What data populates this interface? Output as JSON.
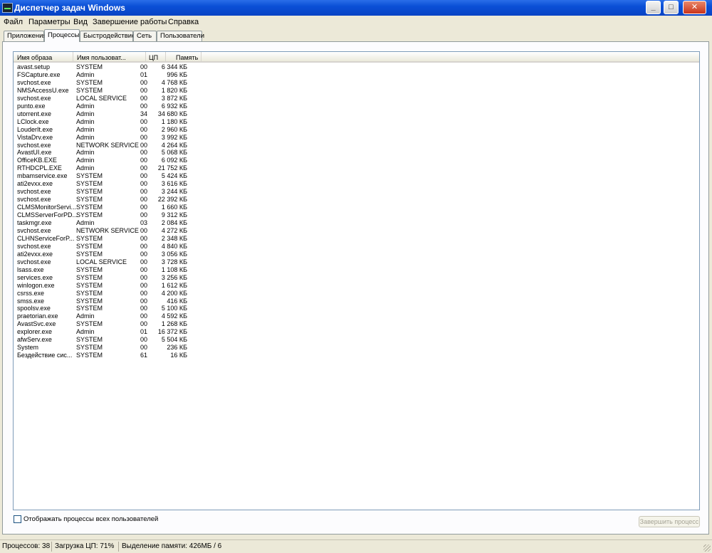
{
  "window": {
    "title": "Диспетчер задач Windows"
  },
  "menu": [
    "Файл",
    "Параметры",
    "Вид",
    "Завершение работы",
    "Справка"
  ],
  "tabs": [
    "Приложения",
    "Процессы",
    "Быстродействие",
    "Сеть",
    "Пользователи"
  ],
  "active_tab": "Процессы",
  "columns": [
    "Имя образа",
    "Имя пользоват...",
    "ЦП",
    "Память"
  ],
  "processes": [
    [
      "avast.setup",
      "SYSTEM",
      "00",
      "6 344 КБ"
    ],
    [
      "FSCapture.exe",
      "Admin",
      "01",
      "996 КБ"
    ],
    [
      "svchost.exe",
      "SYSTEM",
      "00",
      "4 768 КБ"
    ],
    [
      "NMSAccessU.exe",
      "SYSTEM",
      "00",
      "1 820 КБ"
    ],
    [
      "svchost.exe",
      "LOCAL SERVICE",
      "00",
      "3 872 КБ"
    ],
    [
      "punto.exe",
      "Admin",
      "00",
      "6 932 КБ"
    ],
    [
      "utorrent.exe",
      "Admin",
      "34",
      "34 680 КБ"
    ],
    [
      "LClock.exe",
      "Admin",
      "00",
      "1 180 КБ"
    ],
    [
      "LouderIt.exe",
      "Admin",
      "00",
      "2 960 КБ"
    ],
    [
      "VistaDrv.exe",
      "Admin",
      "00",
      "3 992 КБ"
    ],
    [
      "svchost.exe",
      "NETWORK SERVICE",
      "00",
      "4 264 КБ"
    ],
    [
      "AvastUI.exe",
      "Admin",
      "00",
      "5 068 КБ"
    ],
    [
      "OfficeKB.EXE",
      "Admin",
      "00",
      "6 092 КБ"
    ],
    [
      "RTHDCPL.EXE",
      "Admin",
      "00",
      "21 752 КБ"
    ],
    [
      "mbamservice.exe",
      "SYSTEM",
      "00",
      "5 424 КБ"
    ],
    [
      "ati2evxx.exe",
      "SYSTEM",
      "00",
      "3 616 КБ"
    ],
    [
      "svchost.exe",
      "SYSTEM",
      "00",
      "3 244 КБ"
    ],
    [
      "svchost.exe",
      "SYSTEM",
      "00",
      "22 392 КБ"
    ],
    [
      "CLMSMonitorServi...",
      "SYSTEM",
      "00",
      "1 660 КБ"
    ],
    [
      "CLMSServerForPD...",
      "SYSTEM",
      "00",
      "9 312 КБ"
    ],
    [
      "taskmgr.exe",
      "Admin",
      "03",
      "2 084 КБ"
    ],
    [
      "svchost.exe",
      "NETWORK SERVICE",
      "00",
      "4 272 КБ"
    ],
    [
      "CLHNServiceForP...",
      "SYSTEM",
      "00",
      "2 348 КБ"
    ],
    [
      "svchost.exe",
      "SYSTEM",
      "00",
      "4 840 КБ"
    ],
    [
      "ati2evxx.exe",
      "SYSTEM",
      "00",
      "3 056 КБ"
    ],
    [
      "svchost.exe",
      "LOCAL SERVICE",
      "00",
      "3 728 КБ"
    ],
    [
      "lsass.exe",
      "SYSTEM",
      "00",
      "1 108 КБ"
    ],
    [
      "services.exe",
      "SYSTEM",
      "00",
      "3 256 КБ"
    ],
    [
      "winlogon.exe",
      "SYSTEM",
      "00",
      "1 612 КБ"
    ],
    [
      "csrss.exe",
      "SYSTEM",
      "00",
      "4 200 КБ"
    ],
    [
      "smss.exe",
      "SYSTEM",
      "00",
      "416 КБ"
    ],
    [
      "spoolsv.exe",
      "SYSTEM",
      "00",
      "5 100 КБ"
    ],
    [
      "praetorian.exe",
      "Admin",
      "00",
      "4 592 КБ"
    ],
    [
      "AvastSvc.exe",
      "SYSTEM",
      "00",
      "1 268 КБ"
    ],
    [
      "explorer.exe",
      "Admin",
      "01",
      "16 372 КБ"
    ],
    [
      "afwServ.exe",
      "SYSTEM",
      "00",
      "5 504 КБ"
    ],
    [
      "System",
      "SYSTEM",
      "00",
      "236 КБ"
    ],
    [
      "Бездействие сис...",
      "SYSTEM",
      "61",
      "16 КБ"
    ]
  ],
  "show_all_users": {
    "label": "Отображать процессы всех пользователей",
    "checked": false
  },
  "end_process_label": "Завершить процесс",
  "status": {
    "processes": "Процессов: 38",
    "cpu": "Загрузка ЦП: 71%",
    "memory": "Выделение памяти: 426МБ / 6"
  },
  "icons": [
    "taskmgr-app-icon",
    "minimize-icon",
    "maximize-icon",
    "close-icon",
    "size-grip-icon"
  ]
}
